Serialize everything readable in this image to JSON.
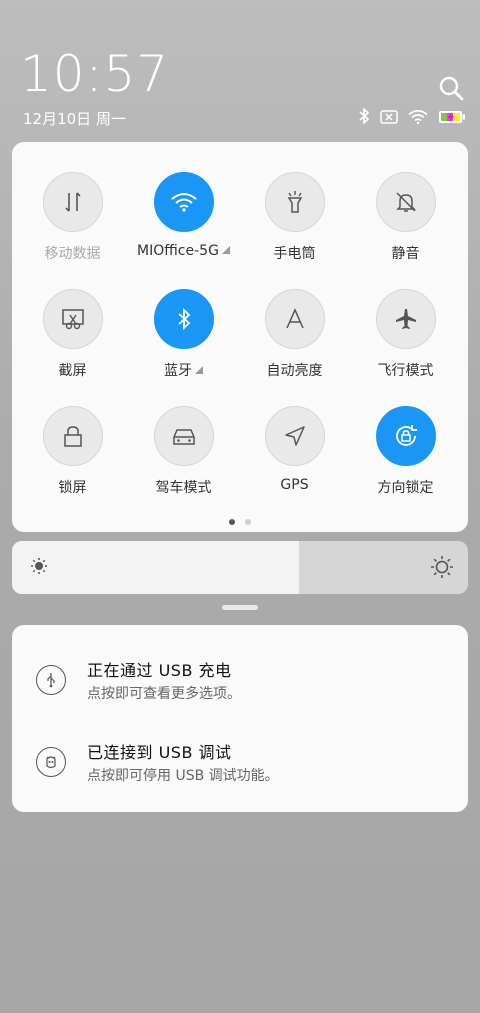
{
  "clock": {
    "time": "10:57",
    "date": "12月10日 周一"
  },
  "status_icons": [
    "bluetooth-icon",
    "sim-disabled-icon",
    "wifi-icon",
    "battery-charging-icon"
  ],
  "quick_settings": [
    {
      "label": "移动数据",
      "icon": "mobile-data-icon",
      "on": false,
      "dim": true
    },
    {
      "label": "MIOffice-5G",
      "icon": "wifi-icon",
      "on": true,
      "expandable": true
    },
    {
      "label": "手电筒",
      "icon": "flashlight-icon",
      "on": false
    },
    {
      "label": "静音",
      "icon": "mute-bell-icon",
      "on": false
    },
    {
      "label": "截屏",
      "icon": "screenshot-icon",
      "on": false
    },
    {
      "label": "蓝牙",
      "icon": "bluetooth-icon",
      "on": true,
      "expandable": true
    },
    {
      "label": "自动亮度",
      "icon": "auto-brightness-icon",
      "on": false
    },
    {
      "label": "飞行模式",
      "icon": "airplane-icon",
      "on": false
    },
    {
      "label": "锁屏",
      "icon": "lock-icon",
      "on": false
    },
    {
      "label": "驾车模式",
      "icon": "car-icon",
      "on": false
    },
    {
      "label": "GPS",
      "icon": "gps-icon",
      "on": false
    },
    {
      "label": "方向锁定",
      "icon": "rotation-lock-icon",
      "on": true
    }
  ],
  "pager": {
    "pages": 2,
    "current": 1
  },
  "brightness": {
    "level_percent": 63
  },
  "notifications": [
    {
      "title": "正在通过 USB 充电",
      "subtitle": "点按即可查看更多选项。",
      "icon": "usb-charging-icon"
    },
    {
      "title": "已连接到 USB 调试",
      "subtitle": "点按即可停用 USB 调试功能。",
      "icon": "usb-debug-icon"
    }
  ],
  "colors": {
    "active": "#1a97f5",
    "panel": "#fafafa",
    "background": "#acacac"
  }
}
